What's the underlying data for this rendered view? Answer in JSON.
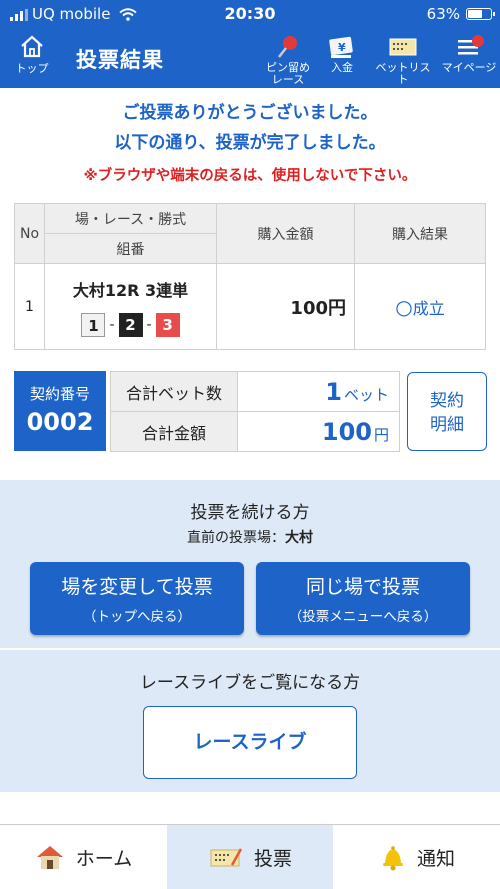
{
  "status": {
    "carrier": "UQ mobile",
    "time": "20:30",
    "battery": "63%",
    "battery_level": 0.63
  },
  "header": {
    "top_label": "トップ",
    "title": "投票結果",
    "pin_label_1": "ピン留め",
    "pin_label_2": "レース",
    "deposit_label": "入金",
    "betlist_label": "ベットリスト",
    "mypage_label": "マイページ"
  },
  "message": {
    "line1": "ご投票ありがとうございました。",
    "line2": "以下の通り、投票が完了しました。",
    "warning": "※ブラウザや端末の戻るは、使用しないで下さい。"
  },
  "table": {
    "headers": {
      "no": "No",
      "race": "場・レース・勝式",
      "combo": "組番",
      "amount": "購入金額",
      "result": "購入結果"
    },
    "rows": [
      {
        "no": "1",
        "race": "大村12R 3連単",
        "b1": "1",
        "b2": "2",
        "b3": "3",
        "dash": "-",
        "amount": "100円",
        "result_mark": "○",
        "result": "成立"
      }
    ]
  },
  "contract": {
    "label": "契約番号",
    "number": "0002",
    "bet_count_label": "合計ベット数",
    "bet_count": "1",
    "bet_unit": "ベット",
    "total_label": "合計金額",
    "total": "100",
    "total_unit": "円",
    "detail_1": "契約",
    "detail_2": "明細"
  },
  "continue": {
    "title": "投票を続ける方",
    "prev_label": "直前の投票場：",
    "prev_venue": "大村",
    "btn1_main": "場を変更して投票",
    "btn1_sub": "（トップへ戻る）",
    "btn2_main": "同じ場で投票",
    "btn2_sub": "（投票メニューへ戻る）"
  },
  "live": {
    "title": "レースライブをご覧になる方",
    "button": "レースライブ"
  },
  "bottom_nav": {
    "home": "ホーム",
    "vote": "投票",
    "notify": "通知"
  },
  "colors": {
    "primary": "#1d63c8",
    "light": "#dde9f7",
    "warning": "#e02020",
    "ball3": "#e84d4d"
  }
}
